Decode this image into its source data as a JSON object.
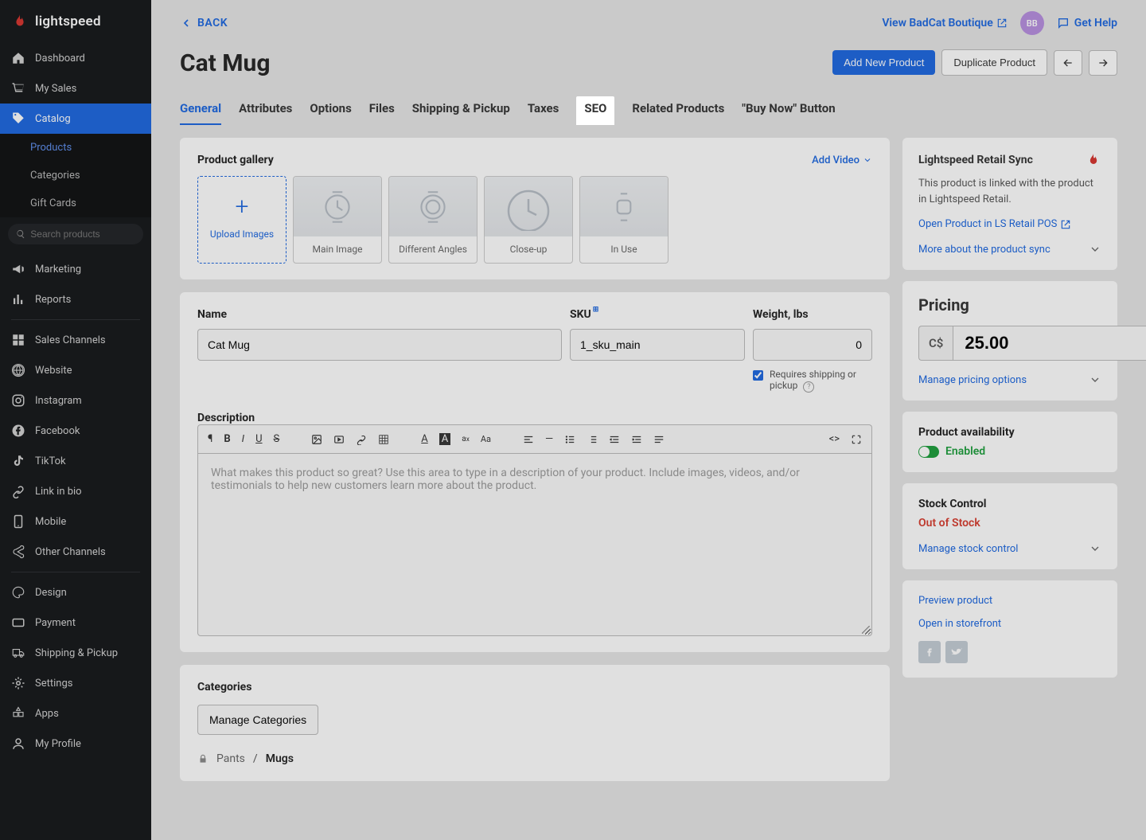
{
  "brand": "lightspeed",
  "sidebar": {
    "items": [
      {
        "label": "Dashboard"
      },
      {
        "label": "My Sales"
      },
      {
        "label": "Catalog"
      },
      {
        "label": "Marketing"
      },
      {
        "label": "Reports"
      },
      {
        "label": "Sales Channels"
      },
      {
        "label": "Website"
      },
      {
        "label": "Instagram"
      },
      {
        "label": "Facebook"
      },
      {
        "label": "TikTok"
      },
      {
        "label": "Link in bio"
      },
      {
        "label": "Mobile"
      },
      {
        "label": "Other Channels"
      },
      {
        "label": "Design"
      },
      {
        "label": "Payment"
      },
      {
        "label": "Shipping & Pickup"
      },
      {
        "label": "Settings"
      },
      {
        "label": "Apps"
      },
      {
        "label": "My Profile"
      }
    ],
    "sub_items": {
      "products": "Products",
      "categories": "Categories",
      "gift_cards": "Gift Cards"
    },
    "search_placeholder": "Search products"
  },
  "header": {
    "back": "BACK",
    "view_store": "View BadCat Boutique",
    "avatar": "BB",
    "get_help": "Get Help",
    "title": "Cat Mug",
    "add_product": "Add New Product",
    "duplicate": "Duplicate Product"
  },
  "tabs": [
    "General",
    "Attributes",
    "Options",
    "Files",
    "Shipping & Pickup",
    "Taxes",
    "SEO",
    "Related Products",
    "\"Buy Now\" Button"
  ],
  "gallery": {
    "title": "Product gallery",
    "add_video": "Add Video",
    "upload": "Upload Images",
    "tiles": [
      "Main Image",
      "Different Angles",
      "Close-up",
      "In Use"
    ]
  },
  "form": {
    "name_label": "Name",
    "name_value": "Cat Mug",
    "sku_label": "SKU",
    "sku_value": "1_sku_main",
    "weight_label": "Weight, lbs",
    "weight_value": "0",
    "requires_shipping": "Requires shipping or pickup",
    "description_label": "Description",
    "description_placeholder": "What makes this product so great? Use this area to type in a description of your product. Include images, videos, and/or testimonials to help new customers learn more about the product."
  },
  "categories": {
    "title": "Categories",
    "manage": "Manage Categories",
    "path": [
      "Pants",
      "Mugs"
    ]
  },
  "sync": {
    "title": "Lightspeed Retail Sync",
    "desc": "This product is linked with the product in Lightspeed Retail.",
    "open_link": "Open Product in LS Retail POS",
    "more": "More about the product sync"
  },
  "pricing": {
    "title": "Pricing",
    "currency": "C$",
    "value": "25.00",
    "manage": "Manage pricing options"
  },
  "availability": {
    "title": "Product availability",
    "status": "Enabled"
  },
  "stock": {
    "title": "Stock Control",
    "status": "Out of Stock",
    "manage": "Manage stock control"
  },
  "links": {
    "preview": "Preview product",
    "storefront": "Open in storefront"
  }
}
